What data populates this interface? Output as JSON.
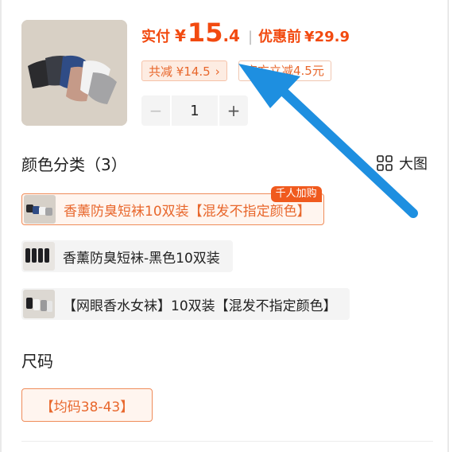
{
  "price": {
    "label": "实付",
    "currency": "¥",
    "integer": "15",
    "decimal": ".4",
    "separator": "|",
    "original_label": "优惠前",
    "original_value": "¥29.9"
  },
  "discount_tag": {
    "text": "共减 ¥14.5",
    "chevron": "›"
  },
  "promo_tag": {
    "text": "官方立减4.5元"
  },
  "stepper": {
    "minus": "−",
    "quantity": "1",
    "plus": "+"
  },
  "color_section": {
    "title": "颜色分类（3）",
    "big_view_label": "大图",
    "big_view_icon": "grid-icon"
  },
  "color_options": [
    {
      "label": "香薰防臭短袜10双装【混发不指定颜色】",
      "badge": "千人加购",
      "selected": true
    },
    {
      "label": "香薰防臭短袜-黑色10双装",
      "selected": false
    },
    {
      "label": "【网眼香水女袜】10双装【混发不指定颜色】",
      "selected": false
    }
  ],
  "size_section": {
    "title": "尺码"
  },
  "size_options": [
    {
      "label": "【均码38-43】",
      "selected": true
    }
  ],
  "colors": {
    "accent": "#f24a10",
    "tag_bg": "#fdece2",
    "arrow": "#1e8fe0"
  }
}
